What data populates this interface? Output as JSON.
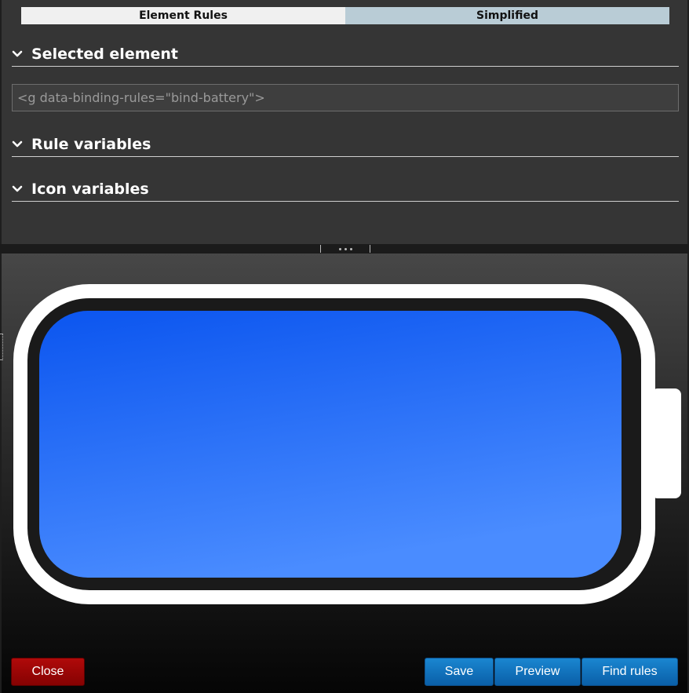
{
  "tabs": [
    {
      "label": "Element Rules"
    },
    {
      "label": "Simplified"
    }
  ],
  "sections": {
    "selected_element": "Selected element",
    "rule_variables": "Rule variables",
    "icon_variables": "Icon variables"
  },
  "selected_element_value": "<g data-binding-rules=\"bind-battery\">",
  "preview": {
    "icon": "battery-icon",
    "battery_level": 1.0,
    "fill_color_top": "#0b55ef",
    "fill_color_bottom": "#4a8cff",
    "outline_color": "#ffffff"
  },
  "buttons": {
    "close": "Close",
    "save": "Save",
    "preview": "Preview",
    "find_rules": "Find rules"
  },
  "colors": {
    "tab_active": "#f0f0f0",
    "tab_inactive": "#b9ccd6",
    "button_blue": "#0a6fbf",
    "button_red": "#9b0707"
  }
}
